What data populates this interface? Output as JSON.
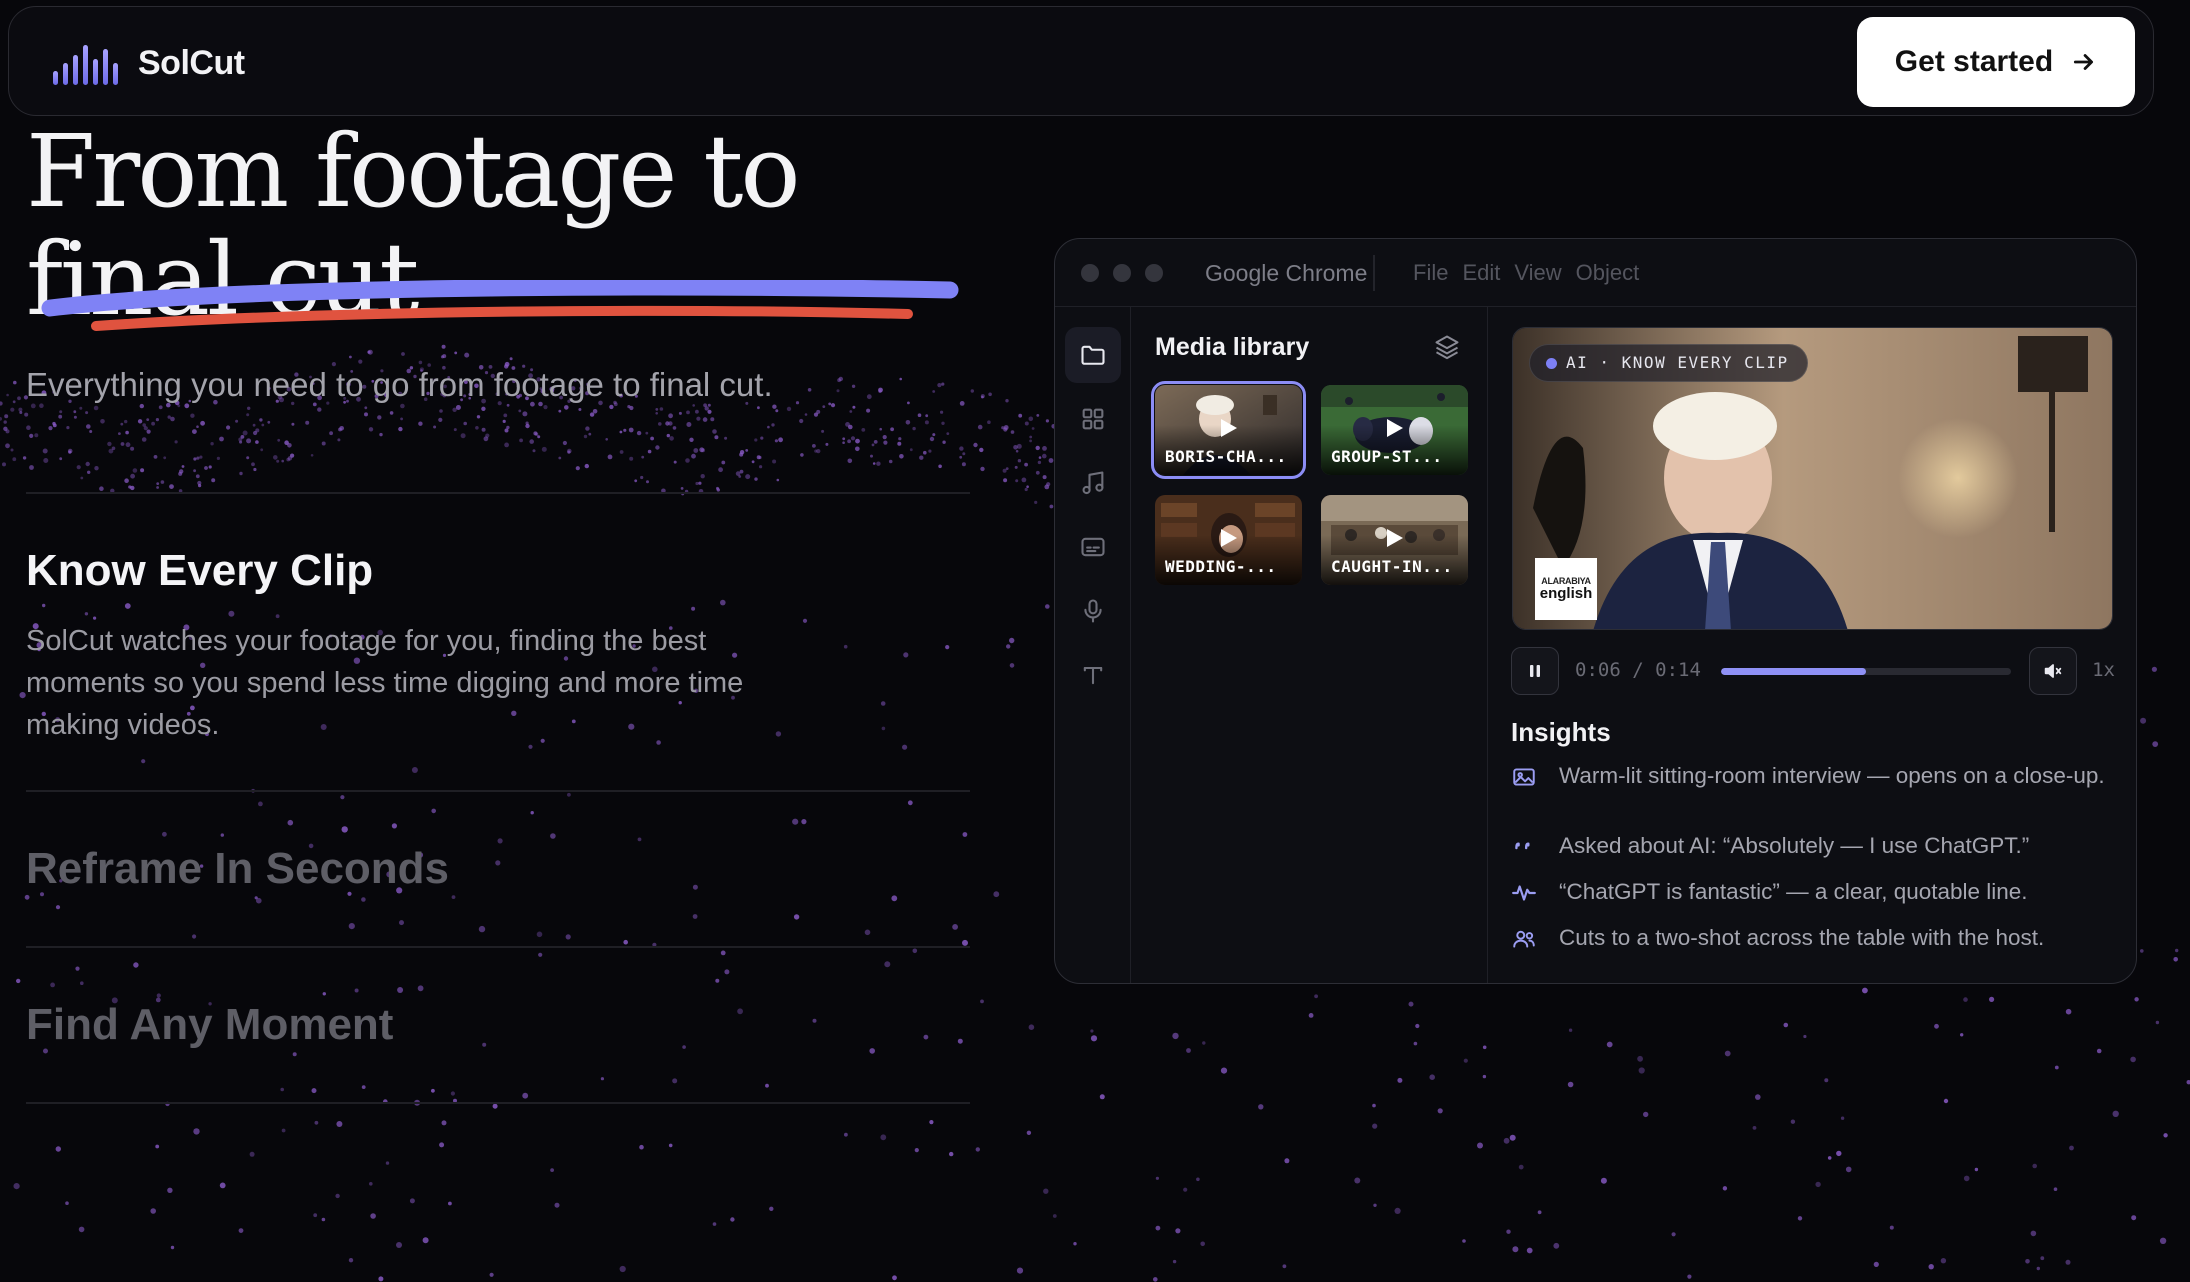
{
  "nav": {
    "brand": "SolCut",
    "cta_label": "Get started",
    "cta_icon": "arrow-right-icon"
  },
  "hero": {
    "title_line1": "From footage to",
    "title_line2": "final cut",
    "subtitle": "Everything you need to go from footage to final cut."
  },
  "features": [
    {
      "title": "Know Every Clip",
      "description": "SolCut watches your footage for you, finding the best moments so you spend less time digging and more time making videos.",
      "active": true
    },
    {
      "title": "Reframe In Seconds",
      "active": false
    },
    {
      "title": "Find Any Moment",
      "active": false
    }
  ],
  "window": {
    "app_name": "Google Chrome",
    "menu": [
      "File",
      "Edit",
      "View",
      "Object"
    ],
    "sidebar_icons": [
      "folder-icon",
      "grid-icon",
      "music-note-icon",
      "captions-icon",
      "microphone-icon",
      "text-icon"
    ],
    "library": {
      "title": "Media library",
      "header_icon": "layers-icon",
      "clips": [
        {
          "label": "BORIS-CHA...",
          "selected": true
        },
        {
          "label": "GROUP-ST...",
          "selected": false
        },
        {
          "label": "WEDDING-...",
          "selected": false
        },
        {
          "label": "CAUGHT-IN...",
          "selected": false
        }
      ]
    },
    "player": {
      "badge": "AI · KNOW EVERY CLIP",
      "channel_logo_line1": "ALARABIYA",
      "channel_logo_line2": "english",
      "current_time": "0:06",
      "separator": "/",
      "duration": "0:14",
      "progress": 0.5,
      "speed": "1x",
      "play_state_icon": "pause-icon",
      "volume_icon": "mute-icon"
    },
    "insights": {
      "title": "Insights",
      "items": [
        {
          "icon": "image-icon",
          "text": "Warm-lit sitting-room interview — opens on a close-up."
        },
        {
          "icon": "quote-icon",
          "text": "Asked about AI: “Absolutely — I use ChatGPT.”"
        },
        {
          "icon": "waveform-icon",
          "text": "“ChatGPT is fantastic” — a clear, quotable line."
        },
        {
          "icon": "people-icon",
          "text": "Cuts to a two-shot across the table with the host."
        }
      ]
    }
  },
  "colors": {
    "background": "#07070b",
    "accent": "#7f82f5",
    "accent_secondary": "#e0533f",
    "dot_particles": "#8a5bc8"
  }
}
